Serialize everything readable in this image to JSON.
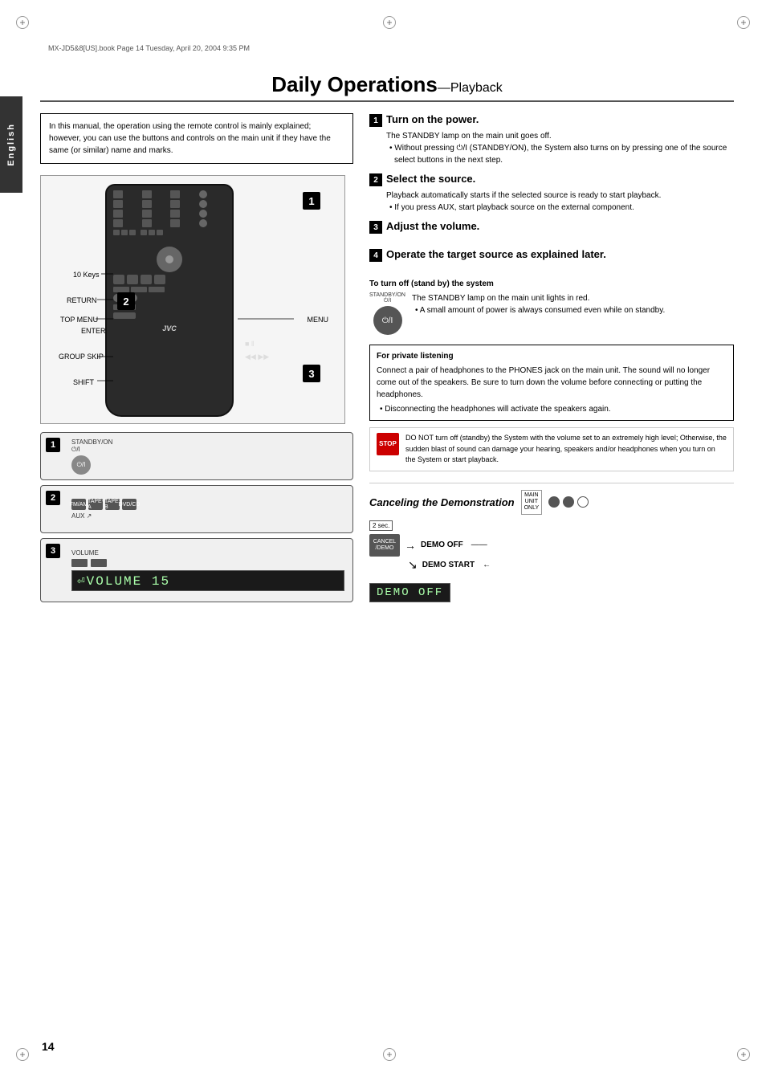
{
  "page": {
    "number": "14",
    "file_info": "MX-JD5&8[US].book  Page 14  Tuesday, April 20, 2004  9:35 PM"
  },
  "title": {
    "main": "Daily Operations",
    "em": "—Playback"
  },
  "side_tab": "English",
  "info_box": {
    "text": "In this manual, the operation using the remote control is mainly explained; however, you can use the buttons and controls on the main unit if they have the same (or similar) name and marks."
  },
  "remote": {
    "labels": {
      "keys_10": "10 Keys",
      "return": "RETURN",
      "top_menu": "TOP MENU",
      "enter": "ENTER",
      "group_skip": "GROUP SKIP",
      "shift": "SHIFT",
      "menu": "MENU"
    },
    "badges": [
      "1",
      "2",
      "3"
    ]
  },
  "steps": [
    {
      "num": "1",
      "title": "Turn on the power.",
      "body": "The STANDBY lamp on the main unit goes off.",
      "bullets": [
        "Without pressing ⏻/I (STANDBY/ON), the System also turns on by pressing one of the source select buttons in the next step."
      ]
    },
    {
      "num": "2",
      "title": "Select the source.",
      "body": "Playback automatically starts if the selected source is ready to start playback.",
      "bullets": [
        "If you press AUX, start playback source on the external component."
      ]
    },
    {
      "num": "3",
      "title": "Adjust the volume.",
      "body": "",
      "bullets": []
    },
    {
      "num": "4",
      "title": "Operate the target source as explained later.",
      "body": "",
      "bullets": []
    }
  ],
  "standby": {
    "section_title": "To turn off (stand by) the system",
    "label": "STANDBY/ON\n⏻/I",
    "text1": "The STANDBY lamp on the main unit lights in red.",
    "bullet1": "A small amount of power is always consumed even while on standby."
  },
  "private_listening": {
    "title": "For private listening",
    "body": "Connect a pair of headphones to the PHONES jack on the main unit. The sound will no longer come out of the speakers. Be sure to turn down the volume before connecting or putting the headphones.",
    "bullet": "Disconnecting the headphones will activate the speakers again."
  },
  "warning": {
    "text": "DO NOT turn off (standby) the System with the volume set to an extremely high level; Otherwise, the sudden blast of sound can damage your hearing, speakers and/or headphones when you turn on the System or start playback."
  },
  "cancel_demo": {
    "title": "Canceling the Demonstration",
    "dots": [
      "filled",
      "filled",
      "open"
    ],
    "main_unit_only": "MAIN\nUNIT\nONLY",
    "sec_label": "2 sec.",
    "button_label": "CANCEL\n/DEMO",
    "arrow1": "DEMO OFF",
    "arrow2": "DEMO START",
    "display_text": "DEMO  OFF"
  },
  "panels": [
    {
      "badge": "1",
      "type": "standby",
      "label": "STANDBY/ON\n⏻/I"
    },
    {
      "badge": "2",
      "type": "source",
      "buttons": [
        "FM/AM",
        "TAPE-A",
        "TAPE-B",
        "DVD/CD"
      ],
      "aux_label": "AUX"
    },
    {
      "badge": "3",
      "type": "volume",
      "label": "VOLUME",
      "display": "VOLUME  15"
    }
  ]
}
